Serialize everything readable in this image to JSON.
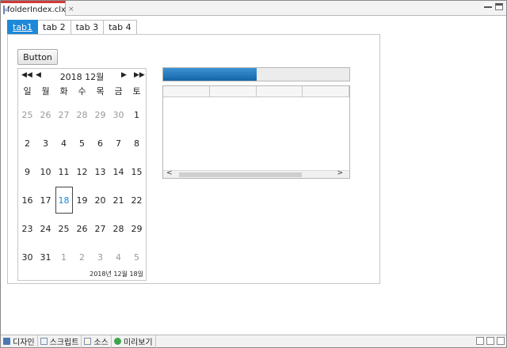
{
  "editor": {
    "file_tab": "folderIndex.clx",
    "close_glyph": "×"
  },
  "form": {
    "tabs": [
      "tab1",
      "tab 2",
      "tab 3",
      "tab 4"
    ],
    "active_tab": "tab1",
    "button_label": "Button"
  },
  "calendar": {
    "title": "2018 12월",
    "nav": {
      "prev_year": "◀◀",
      "prev_month": "◀",
      "next_month": "▶",
      "next_year": "▶▶"
    },
    "weekdays": [
      "일",
      "월",
      "화",
      "수",
      "목",
      "금",
      "토"
    ],
    "weeks": [
      [
        "25",
        "26",
        "27",
        "28",
        "29",
        "30",
        "1"
      ],
      [
        "2",
        "3",
        "4",
        "5",
        "6",
        "7",
        "8"
      ],
      [
        "9",
        "10",
        "11",
        "12",
        "13",
        "14",
        "15"
      ],
      [
        "16",
        "17",
        "18",
        "19",
        "20",
        "21",
        "22"
      ],
      [
        "23",
        "24",
        "25",
        "26",
        "27",
        "28",
        "29"
      ],
      [
        "30",
        "31",
        "1",
        "2",
        "3",
        "4",
        "5"
      ]
    ],
    "selected": "18",
    "footer": "2018년 12월 18일"
  },
  "progress": {
    "value_fraction": 0.5,
    "fill_color": "#1e6fb5"
  },
  "grid": {
    "header_cells": [
      "",
      "",
      "",
      ""
    ],
    "scroll_left": "<",
    "scroll_right": ">"
  },
  "statusbar": {
    "design": "디자인",
    "script": "스크립트",
    "source": "소스",
    "preview": "미리보기"
  },
  "colors": {
    "accent": "#1e88d8",
    "tab_marker": "#d23a3a"
  }
}
